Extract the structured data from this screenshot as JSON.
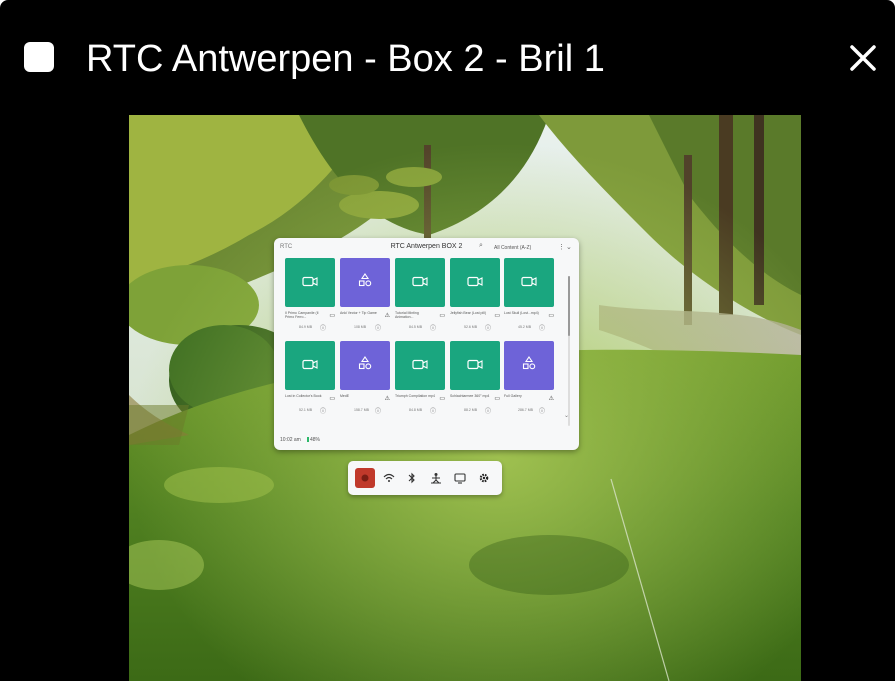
{
  "window": {
    "title": "RTC Antwerpen - Box 2 - Bril 1",
    "close_icon": "close-icon",
    "checkbox_icon": "window-square-icon"
  },
  "panel": {
    "logo": "RTC",
    "title": "RTC Antwerpen BOX 2",
    "search_icon": "⌕",
    "filter": "All Content (A-Z)",
    "more_icon": "⋮",
    "chevron_icon": "⌄",
    "time": "10:02 am",
    "battery": "48%",
    "scroll_down_icon": "⌄",
    "tiles": [
      {
        "type": "video",
        "name": "Il Primo Campanile (Il Primo Ferro...",
        "icon": "▭",
        "size": "84.9 MB"
      },
      {
        "type": "app",
        "name": "Anki Vector + Tip Game",
        "icon": "⚠",
        "size": "108 MB"
      },
      {
        "type": "video",
        "name": "Tutorial Minting Animation...",
        "icon": "▭",
        "size": "84.5 MB"
      },
      {
        "type": "video",
        "name": "Jellyfish Bear (Lost pill)",
        "icon": "▭",
        "size": "52.6 MB"
      },
      {
        "type": "video",
        "name": "Lost Skull (Lost...mp4)",
        "icon": "▭",
        "size": "45.2 MB"
      },
      {
        "type": "video",
        "name": "Lost in Collector's Book",
        "icon": "▭",
        "size": "52.1 MB"
      },
      {
        "type": "app",
        "name": "MedE",
        "icon": "⚠",
        "size": "158.7 MB"
      },
      {
        "type": "video",
        "name": "Triumph Compilation mp4",
        "icon": "▭",
        "size": "84.8 MB"
      },
      {
        "type": "video",
        "name": "Schlachtarmee 360° mp4",
        "icon": "▭",
        "size": "88.2 MB"
      },
      {
        "type": "app",
        "name": "Full Gallery",
        "icon": "⚠",
        "size": "286.7 MB"
      }
    ]
  },
  "dock": {
    "record_icon": "record-icon",
    "wifi_icon": "wifi-icon",
    "bluetooth_icon": "bluetooth-icon",
    "person_icon": "guardian-icon",
    "cast_icon": "cast-icon",
    "settings_icon": "settings-icon"
  },
  "colors": {
    "window_bg": "#000000",
    "video_tile": "#1aa67f",
    "app_tile": "#6e63d8",
    "record": "#c0392b"
  }
}
